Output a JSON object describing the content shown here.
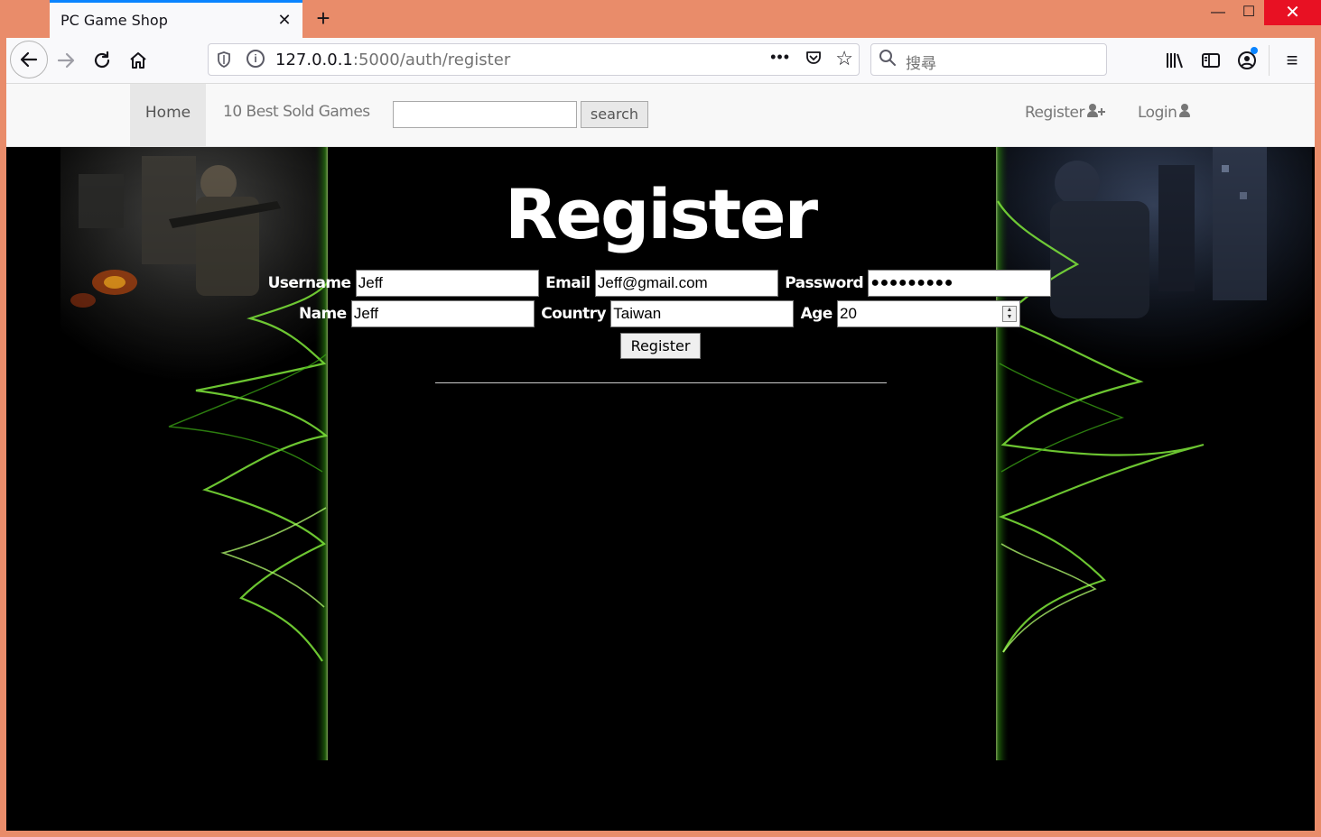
{
  "browser": {
    "tab_title": "PC Game Shop",
    "url_host": "127.0.0.1",
    "url_rest": ":5000/auth/register",
    "search_placeholder": "搜尋",
    "accent_color": "#0a84ff",
    "frame_color": "#e98c6a"
  },
  "nav": {
    "home": "Home",
    "best_sold": "10 Best Sold Games",
    "search_value": "",
    "search_button": "search",
    "register": "Register",
    "login": "Login"
  },
  "page": {
    "title": "Register",
    "button": "Register"
  },
  "form": {
    "username_label": "Username",
    "username_value": "Jeff",
    "email_label": "Email",
    "email_value": "Jeff@gmail.com",
    "password_label": "Password",
    "password_value": "●●●●●●●●●",
    "name_label": "Name",
    "name_value": "Jeff",
    "country_label": "Country",
    "country_value": "Taiwan",
    "age_label": "Age",
    "age_value": "20"
  },
  "icons": {
    "register": "user-plus-icon",
    "login": "user-icon"
  }
}
